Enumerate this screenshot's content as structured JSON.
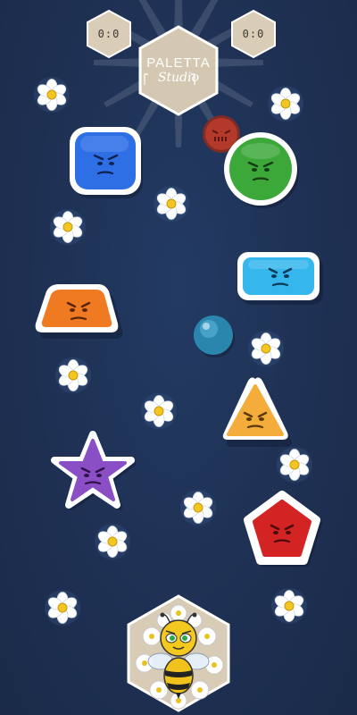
{
  "hud": {
    "score_left": "0:0",
    "score_right": "0:0",
    "logo_title": "PALETTA",
    "logo_subtitle": "Studio"
  },
  "colors": {
    "background": "#1f3154",
    "hex_fill": "#d9cdb8",
    "blue": "#2f6fe6",
    "green": "#3da83a",
    "cyan": "#35b7ee",
    "orange": "#f07a22",
    "yellow": "#f4ac3a",
    "purple": "#8a4fc4",
    "red": "#d42323",
    "ball": "#3aa0c8"
  },
  "pieces": [
    {
      "name": "blue-rounded-square",
      "color": "blue"
    },
    {
      "name": "green-circle",
      "color": "green"
    },
    {
      "name": "cyan-rectangle",
      "color": "cyan"
    },
    {
      "name": "orange-trapezoid",
      "color": "orange"
    },
    {
      "name": "yellow-triangle",
      "color": "yellow"
    },
    {
      "name": "purple-star",
      "color": "purple"
    },
    {
      "name": "red-pentagon",
      "color": "red"
    }
  ],
  "player": {
    "character": "bee-icon"
  },
  "decor": {
    "flower_icon": "daisy-flower-icon",
    "mine_icon": "spiky-red-ball-icon"
  }
}
